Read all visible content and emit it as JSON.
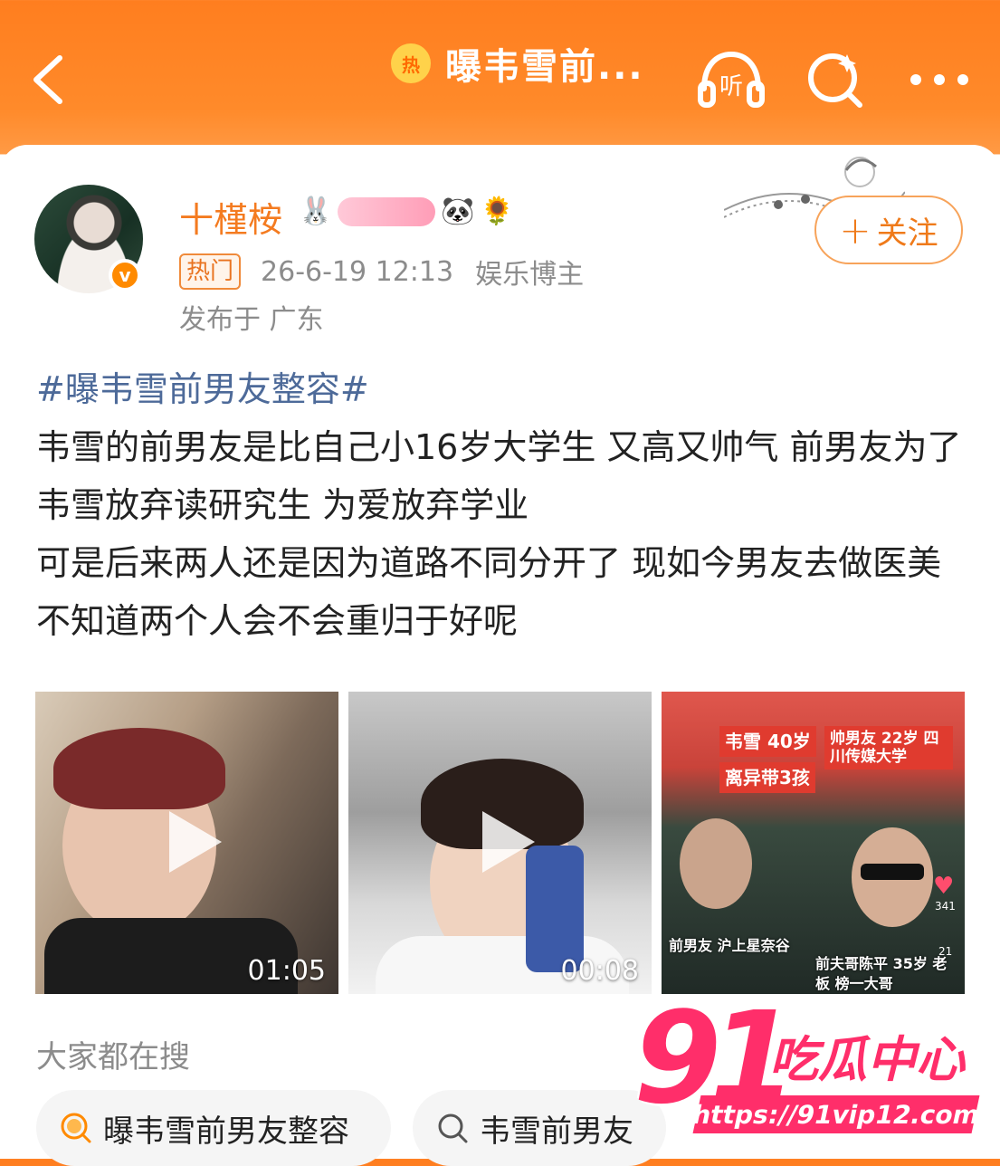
{
  "header": {
    "title": "曝韦雪前...",
    "hot_icon_label": "热",
    "listen_label": "听"
  },
  "post": {
    "username": "十槿桉",
    "verified_badge": "v",
    "hot_tag": "热门",
    "time": "26-6-19 12:13",
    "category": "娱乐博主",
    "location": "发布于 广东",
    "follow_label": "关注",
    "hashtag": "#曝韦雪前男友整容#",
    "paragraphs": [
      "韦雪的前男友是比自己小16岁大学生 又高又帅气 前男友为了韦雪放弃读研究生 为爱放弃学业",
      "可是后来两人还是因为道路不同分开了 现如今男友去做医美 不知道两个人会不会重归于好呢"
    ]
  },
  "media": [
    {
      "duration": "01:05"
    },
    {
      "duration": "00:08"
    },
    {
      "tag_left_1": "韦雪 40岁",
      "tag_left_2": "离异带3孩",
      "tag_right": "帅男友 22岁 四川传媒大学",
      "caption_left": "前男友 沪上星奈谷",
      "caption_right": "前夫哥陈平 35岁 老板 榜一大哥",
      "count1": "341",
      "count2": "21"
    }
  ],
  "search": {
    "label": "大家都在搜",
    "chips": [
      {
        "text": "曝韦雪前男友整容",
        "icon": "hot-search-icon"
      },
      {
        "text": "韦雪前男友",
        "icon": "search-icon"
      }
    ]
  },
  "watermark": {
    "number": "91",
    "text": "吃瓜中心",
    "url": "https://91vip12.com"
  },
  "colors": {
    "header_orange": "#ff7e1f",
    "username": "#f47b20",
    "hashtag": "#4d6a99",
    "watermark": "#ff2e6a"
  }
}
